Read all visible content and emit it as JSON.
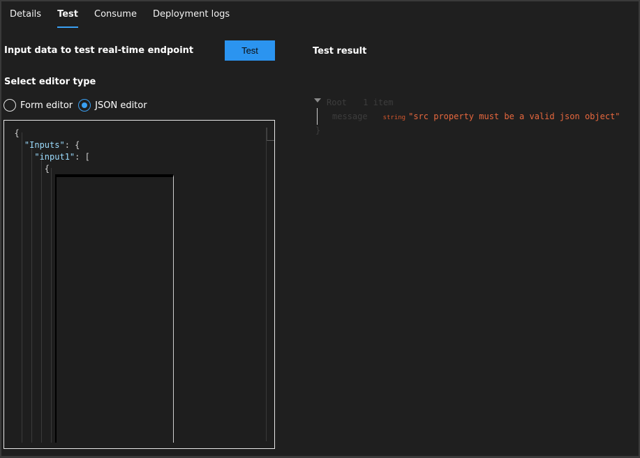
{
  "tabs": [
    {
      "label": "Details"
    },
    {
      "label": "Test"
    },
    {
      "label": "Consume"
    },
    {
      "label": "Deployment logs"
    }
  ],
  "active_tab": "Test",
  "left_panel": {
    "title": "Input data to test real-time endpoint",
    "test_button": "Test",
    "editor_type_label": "Select editor type",
    "options": [
      {
        "label": "Form editor",
        "selected": false
      },
      {
        "label": "JSON editor",
        "selected": true
      }
    ]
  },
  "editor": {
    "lines": [
      {
        "indent": "  ",
        "text": "{",
        "key": ""
      },
      {
        "indent": "    ",
        "key": "\"Inputs\"",
        "text": ": {"
      },
      {
        "indent": "      ",
        "key": "\"input1\"",
        "text": ": ["
      },
      {
        "indent": "        ",
        "text": "{",
        "key": ""
      }
    ]
  },
  "result": {
    "title": "Test result",
    "root_label": "Root",
    "root_count": "1 item",
    "entry_key": "message",
    "entry_type": "string",
    "entry_value": "\"src property must be a valid json object\"",
    "close_label": "}"
  },
  "colors": {
    "accent": "#3aa0f3",
    "button": "#2b94f0",
    "json_key": "#9cdcfe",
    "string_value": "#e8683e",
    "background": "#1f1f1f"
  }
}
